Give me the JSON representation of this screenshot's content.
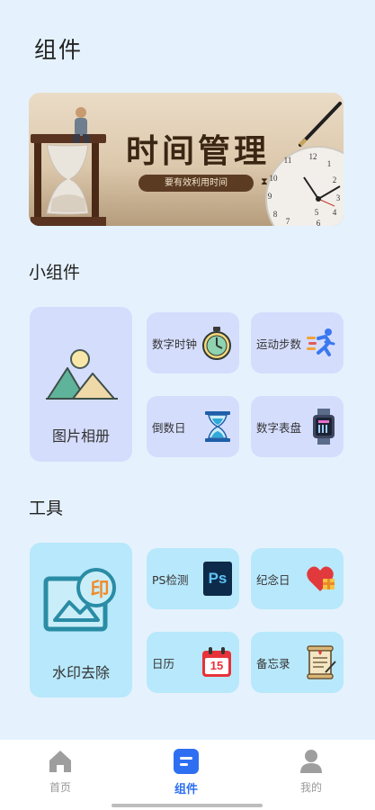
{
  "page": {
    "title": "组件"
  },
  "banner": {
    "title": "时间管理",
    "subtitle": "要有效利用时间",
    "clock_numerals": [
      "12",
      "1",
      "2",
      "3",
      "4",
      "5",
      "6",
      "7",
      "8",
      "9",
      "10",
      "11"
    ]
  },
  "widgets_section": {
    "title": "小组件",
    "big_card": {
      "label": "图片相册",
      "icon": "photo-album-icon"
    },
    "cards": [
      {
        "label": "数字时钟",
        "icon": "stopwatch-icon"
      },
      {
        "label": "运动步数",
        "icon": "running-icon"
      },
      {
        "label": "倒数日",
        "icon": "hourglass-icon"
      },
      {
        "label": "数字表盘",
        "icon": "digital-watch-icon"
      }
    ]
  },
  "tools_section": {
    "title": "工具",
    "big_card": {
      "label": "水印去除",
      "icon": "watermark-icon",
      "stamp_text": "印"
    },
    "cards": [
      {
        "label": "PS检测",
        "icon": "photoshop-icon",
        "icon_text": "Ps"
      },
      {
        "label": "纪念日",
        "icon": "heart-gift-icon"
      },
      {
        "label": "日历",
        "icon": "calendar-icon",
        "icon_text": "15"
      },
      {
        "label": "备忘录",
        "icon": "memo-scroll-icon"
      }
    ]
  },
  "bottom_nav": {
    "items": [
      {
        "label": "首页",
        "icon": "home-icon",
        "active": false
      },
      {
        "label": "组件",
        "icon": "widgets-icon",
        "active": true
      },
      {
        "label": "我的",
        "icon": "profile-icon",
        "active": false
      }
    ],
    "active_color": "#2E6FF2",
    "inactive_color": "#999999"
  },
  "colors": {
    "background": "#E5F2FD",
    "widget_card": "#D5DDFD",
    "tool_card": "#B8E8FB"
  }
}
